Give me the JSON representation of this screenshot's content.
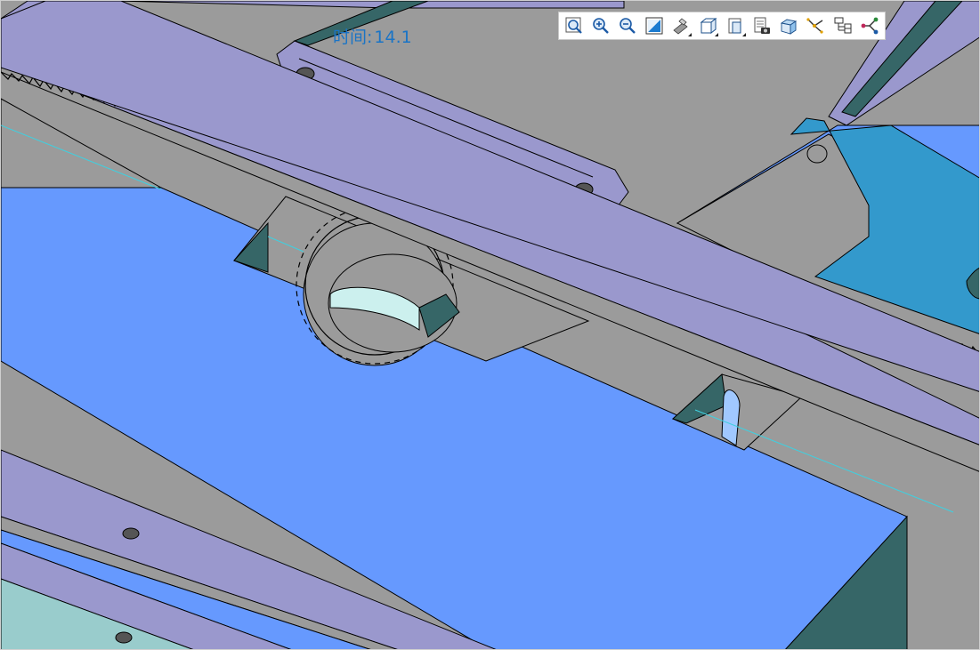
{
  "viewer": {
    "time_label": "时间:",
    "time_value": "14.1"
  },
  "toolbar": {
    "buttons": [
      {
        "icon": "zoom-fit-icon"
      },
      {
        "icon": "zoom-in-icon"
      },
      {
        "icon": "zoom-out-icon"
      },
      {
        "icon": "zoom-window-icon"
      },
      {
        "icon": "view-orientation-icon"
      },
      {
        "icon": "display-style-icon"
      },
      {
        "icon": "view-options-icon"
      },
      {
        "icon": "snapshot-icon"
      },
      {
        "icon": "section-view-icon"
      },
      {
        "icon": "explode-icon"
      },
      {
        "icon": "model-tree-icon"
      },
      {
        "icon": "connections-icon"
      }
    ]
  },
  "colors": {
    "plate_blue": "#6699fe",
    "rack_purple": "#9a98cd",
    "metal_gray": "#9b9b9b",
    "shadow_teal": "#366667",
    "bracket_blue": "#3399cc",
    "time_text": "#1a74c6"
  }
}
